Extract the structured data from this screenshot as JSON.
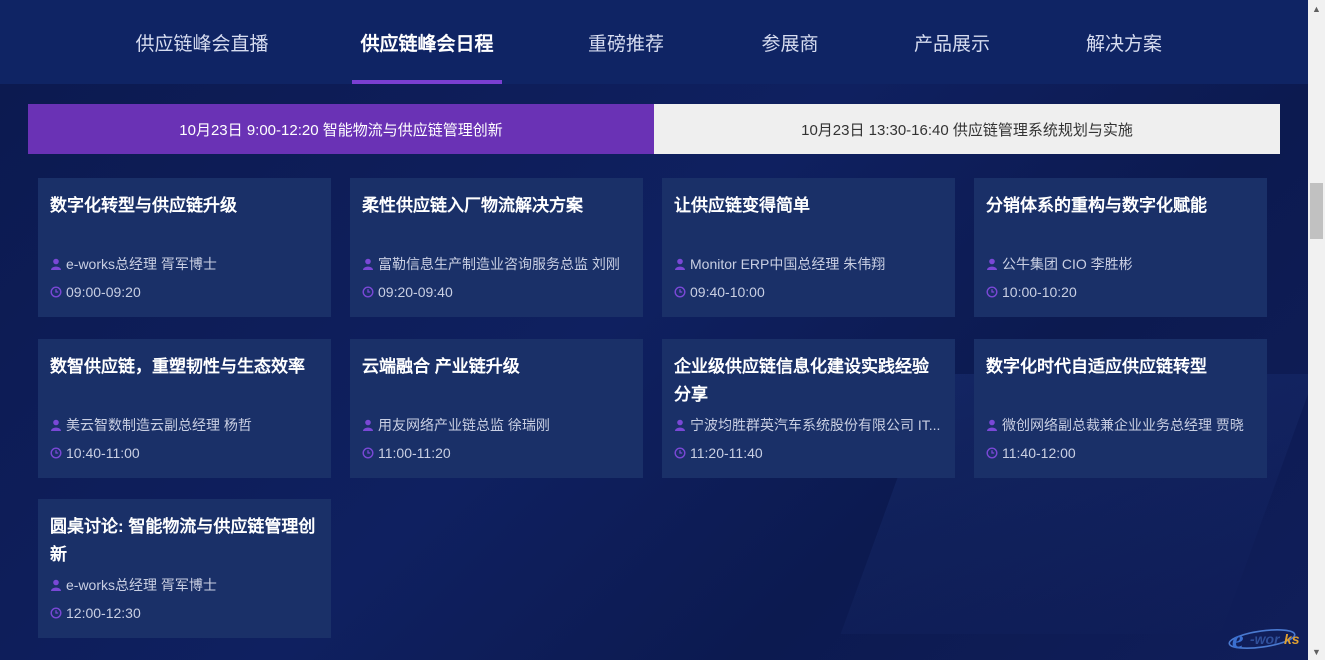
{
  "nav": {
    "items": [
      {
        "label": "供应链峰会直播"
      },
      {
        "label": "供应链峰会日程"
      },
      {
        "label": "重磅推荐"
      },
      {
        "label": "参展商"
      },
      {
        "label": "产品展示"
      },
      {
        "label": "解决方案"
      }
    ],
    "active_index": 1
  },
  "sessions": {
    "tabs": [
      {
        "label": "10月23日 9:00-12:20 智能物流与供应链管理创新",
        "active": true
      },
      {
        "label": "10月23日 13:30-16:40 供应链管理系统规划与实施",
        "active": false
      }
    ]
  },
  "talks": [
    {
      "title": "数字化转型与供应链升级",
      "speaker": "e-works总经理 胥军博士",
      "time": "09:00-09:20"
    },
    {
      "title": "柔性供应链入厂物流解决方案",
      "speaker": "富勒信息生产制造业咨询服务总监 刘刚",
      "time": "09:20-09:40"
    },
    {
      "title": "让供应链变得简单",
      "speaker": "Monitor ERP中国总经理 朱伟翔",
      "time": "09:40-10:00"
    },
    {
      "title": "分销体系的重构与数字化赋能",
      "speaker": "公牛集团 CIO 李胜彬",
      "time": "10:00-10:20"
    },
    {
      "title": "数智供应链，重塑韧性与生态效率",
      "speaker": "美云智数制造云副总经理 杨哲",
      "time": "10:40-11:00"
    },
    {
      "title": "云端融合 产业链升级",
      "speaker": "用友网络产业链总监 徐瑞刚",
      "time": "11:00-11:20"
    },
    {
      "title": "企业级供应链信息化建设实践经验分享",
      "speaker": "宁波均胜群英汽车系统股份有限公司 IT...",
      "time": "11:20-11:40"
    },
    {
      "title": "数字化时代自适应供应链转型",
      "speaker": "微创网络副总裁兼企业业务总经理 贾晓",
      "time": "11:40-12:00"
    },
    {
      "title": "圆桌讨论: 智能物流与供应链管理创新",
      "speaker": "e-works总经理 胥军博士",
      "time": "12:00-12:30"
    }
  ],
  "icons": {
    "speaker": "user-icon",
    "time": "clock-icon"
  },
  "colors": {
    "accent": "#7a3fd1",
    "active_tab": "#6a32b5",
    "card_bg": "#1a3068",
    "nav_bg": "#0f2464",
    "page_bg": "#0d1a52",
    "icon_purple": "#7a48d6"
  },
  "logo": {
    "text": "e-works"
  }
}
